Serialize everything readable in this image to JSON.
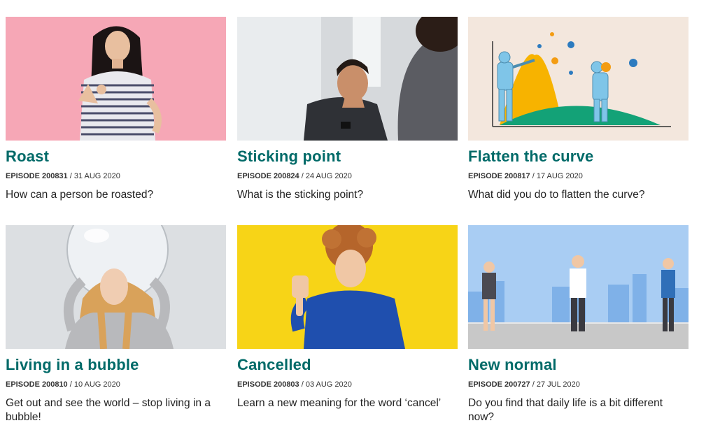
{
  "episodes": [
    {
      "title": "Roast",
      "episode_label": "EPISODE 200831",
      "date": "31 AUG 2020",
      "description": "How can a person be roasted?",
      "bg": "#f6a7b6"
    },
    {
      "title": "Sticking point",
      "episode_label": "EPISODE 200824",
      "date": "24 AUG 2020",
      "description": "What is the sticking point?",
      "bg": "#cfd3d6"
    },
    {
      "title": "Flatten the curve",
      "episode_label": "EPISODE 200817",
      "date": "17 AUG 2020",
      "description": "What did you do to flatten the curve?",
      "bg": "#f3e7dd"
    },
    {
      "title": "Living in a bubble",
      "episode_label": "EPISODE 200810",
      "date": "10 AUG 2020",
      "description": "Get out and see the world – stop living in a bubble!",
      "bg": "#d9dde1"
    },
    {
      "title": "Cancelled",
      "episode_label": "EPISODE 200803",
      "date": "03 AUG 2020",
      "description": "Learn a new meaning for the word ‘cancel’",
      "bg": "#f7d417"
    },
    {
      "title": "New normal",
      "episode_label": "EPISODE 200727",
      "date": "27 JUL 2020",
      "description": "Do you find that daily life is a bit different now?",
      "bg": "#a9cdf3"
    }
  ],
  "colors": {
    "title": "#006a68"
  }
}
